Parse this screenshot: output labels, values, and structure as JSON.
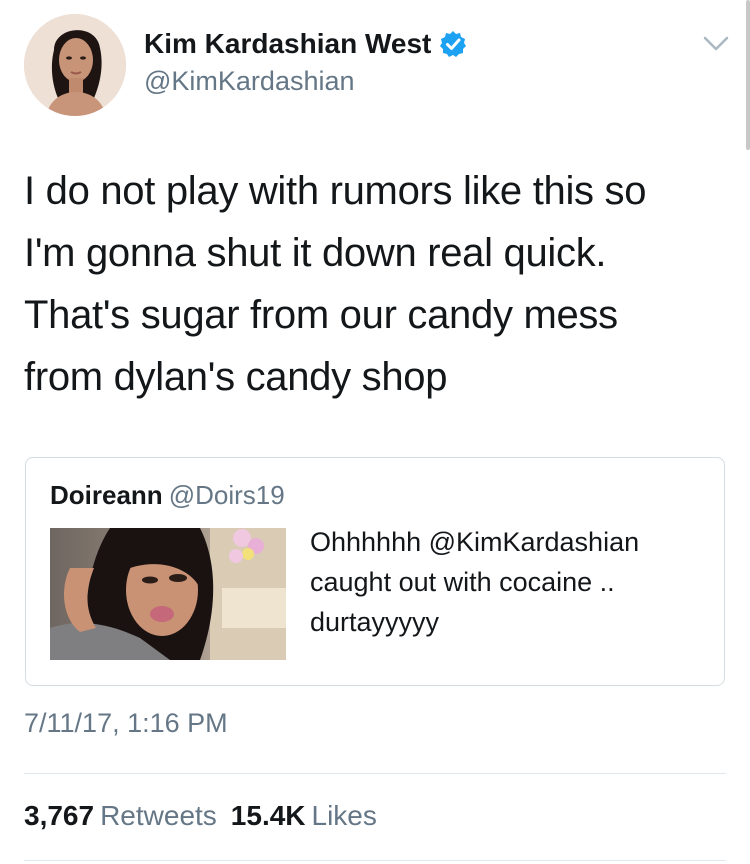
{
  "author": {
    "display_name": "Kim Kardashian West",
    "handle": "@KimKardashian",
    "verified": true,
    "avatar_icon": "profile-photo"
  },
  "tweet": {
    "lines": [
      "I do not play with rumors like this so",
      "I'm gonna shut it down real quick.",
      "That's sugar from our candy mess",
      "from dylan's candy shop"
    ]
  },
  "quoted_tweet": {
    "name": "Doireann",
    "handle": "@Doirs19",
    "lines": [
      "Ohhhhhh @KimKardashian",
      "caught out with cocaine ..",
      "durtayyyyy"
    ],
    "thumbnail_icon": "selfie-photo"
  },
  "timestamp": "7/11/17, 1:16 PM",
  "stats": {
    "retweets_count": "3,767",
    "retweets_label": "Retweets",
    "likes_count": "15.4K",
    "likes_label": "Likes"
  },
  "colors": {
    "text": "#14171a",
    "secondary": "#657786",
    "verified": "#1da1f2",
    "border": "#d5dde2"
  }
}
